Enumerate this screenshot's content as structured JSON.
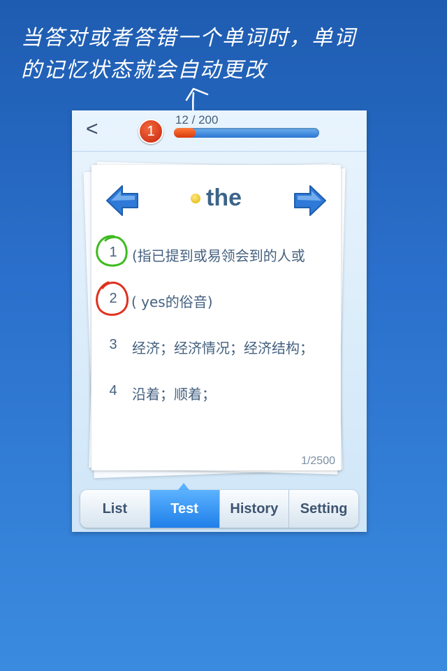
{
  "annotation": {
    "line1": "当答对或者答错一个单词时，单词",
    "line2": "的记忆状态就会自动更改"
  },
  "header": {
    "back_icon": "<",
    "badge": "1",
    "progress": {
      "current": 12,
      "total": 200,
      "label": "12 / 200",
      "fraction": 0.06
    }
  },
  "card": {
    "word": "the",
    "prev_icon": "arrow-left-icon",
    "next_icon": "arrow-right-icon",
    "definitions": [
      {
        "num": "1",
        "text": "(指已提到或易领会到的人或",
        "mark": "correct"
      },
      {
        "num": "2",
        "text": "( yes的俗音)",
        "mark": "wrong"
      },
      {
        "num": "3",
        "text": "经济；经济情况；经济结构；",
        "mark": ""
      },
      {
        "num": "4",
        "text": "沿着；顺着；",
        "mark": ""
      }
    ],
    "count": "1/2500"
  },
  "tabs": [
    {
      "label": "List",
      "active": false
    },
    {
      "label": "Test",
      "active": true
    },
    {
      "label": "History",
      "active": false
    },
    {
      "label": "Setting",
      "active": false
    }
  ],
  "colors": {
    "background": "#2a6fcb",
    "correct_circle": "#3dbb1f",
    "wrong_circle": "#e0311f",
    "accent": "#1e7fe8"
  }
}
